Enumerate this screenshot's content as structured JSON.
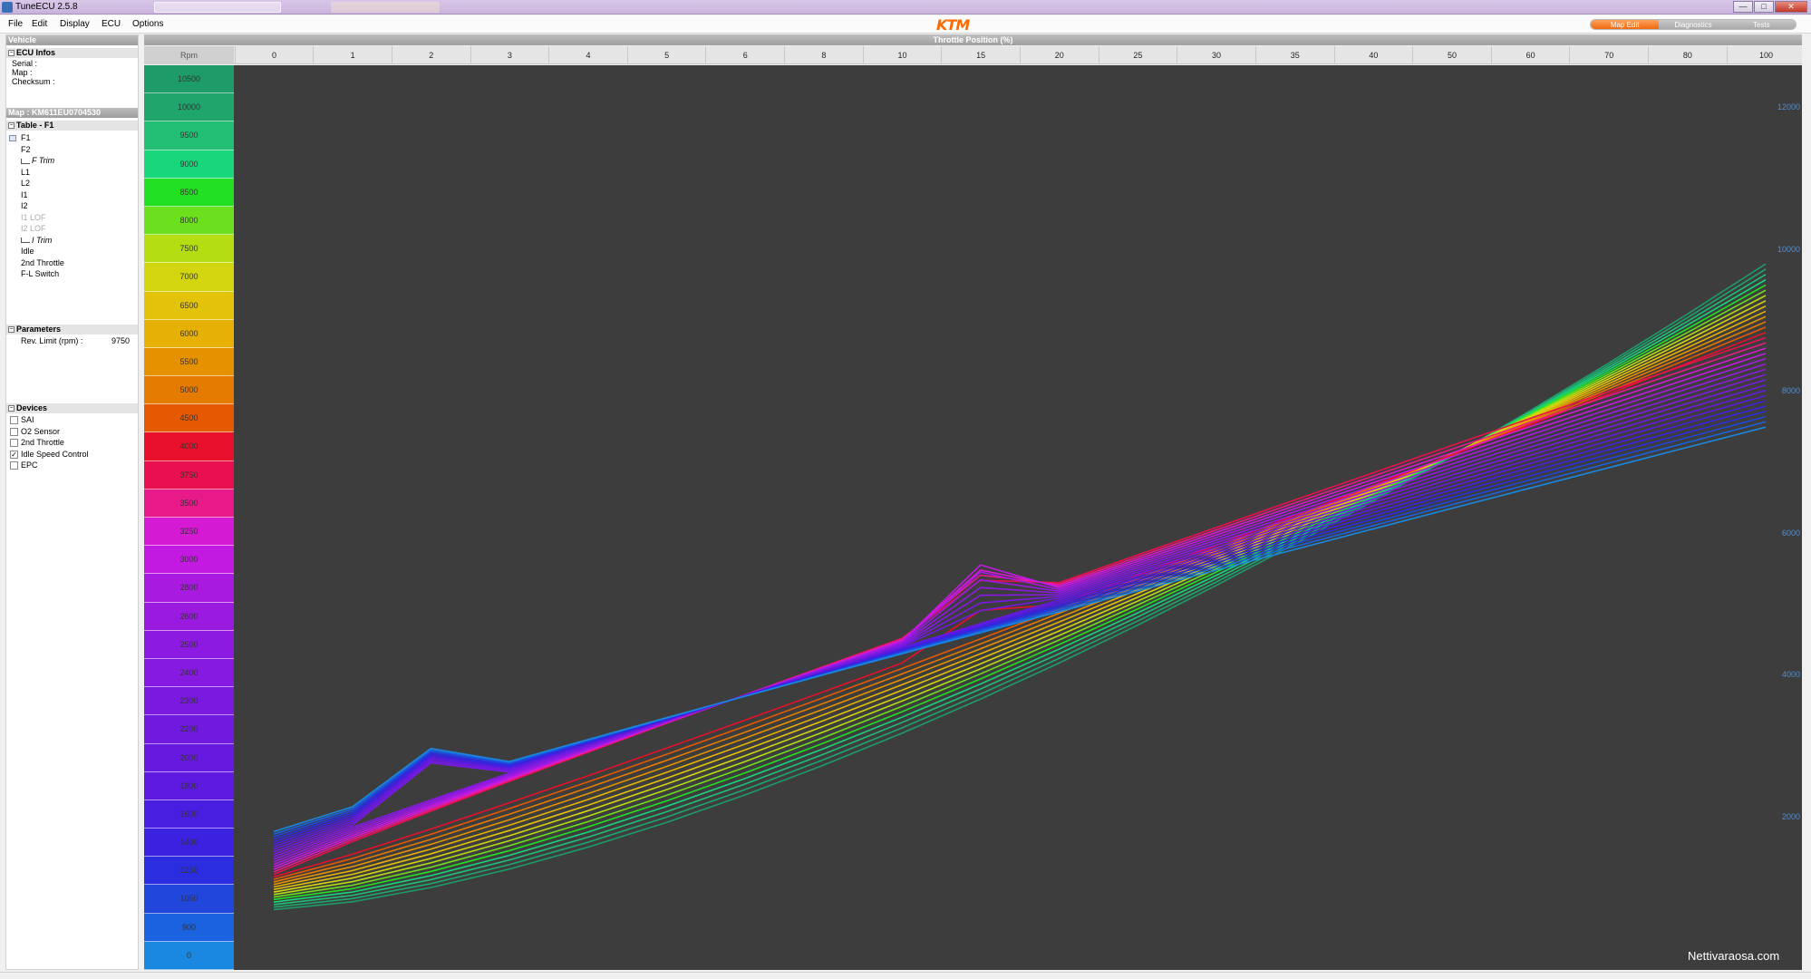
{
  "window": {
    "title": "TuneECU 2.5.8",
    "minimize": "—",
    "maximize": "□",
    "close": "✕"
  },
  "menu": [
    "File",
    "Edit",
    "Display",
    "ECU",
    "Options"
  ],
  "logo": "KTM",
  "mode_tabs": [
    {
      "label": "Map Edit",
      "active": true
    },
    {
      "label": "Diagnostics",
      "active": false
    },
    {
      "label": "Tests",
      "active": false
    }
  ],
  "left": {
    "vehicle_header": "Vehicle",
    "ecu_infos": {
      "label": "ECU Infos",
      "fields": [
        "Serial :",
        "Map :",
        "Checksum :"
      ]
    },
    "map_header": "Map : KM611EU0704530",
    "table": {
      "label": "Table - F1",
      "items": [
        {
          "label": "F1",
          "dim": false,
          "italic": false,
          "icon": "table-icon"
        },
        {
          "label": "F2",
          "dim": false,
          "italic": false
        },
        {
          "label": "F Trim",
          "dim": false,
          "italic": true,
          "icon": "trim-icon"
        },
        {
          "label": "L1",
          "dim": false,
          "italic": false
        },
        {
          "label": "L2",
          "dim": false,
          "italic": false
        },
        {
          "label": "I1",
          "dim": false,
          "italic": false
        },
        {
          "label": "I2",
          "dim": false,
          "italic": false
        },
        {
          "label": "I1 LOF",
          "dim": true,
          "italic": false
        },
        {
          "label": "I2 LOF",
          "dim": true,
          "italic": false
        },
        {
          "label": "I Trim",
          "dim": false,
          "italic": true,
          "icon": "trim-icon"
        },
        {
          "label": "Idle",
          "dim": false,
          "italic": false
        },
        {
          "label": "2nd Throttle",
          "dim": false,
          "italic": false
        },
        {
          "label": "F-L Switch",
          "dim": false,
          "italic": false
        }
      ]
    },
    "parameters": {
      "label": "Parameters",
      "rev_limit_label": "Rev. Limit (rpm) :",
      "rev_limit_value": "9750"
    },
    "devices": {
      "label": "Devices",
      "items": [
        {
          "label": "SAI",
          "checked": false
        },
        {
          "label": "O2 Sensor",
          "checked": false
        },
        {
          "label": "2nd Throttle",
          "checked": false
        },
        {
          "label": "Idle Speed Control",
          "checked": true
        },
        {
          "label": "EPC",
          "checked": false
        }
      ]
    }
  },
  "chart_data": {
    "type": "line",
    "title": "Throttle Position (%)",
    "row_header": "Rpm",
    "x": [
      "0",
      "1",
      "2",
      "3",
      "4",
      "5",
      "6",
      "8",
      "10",
      "15",
      "20",
      "25",
      "30",
      "35",
      "40",
      "50",
      "60",
      "70",
      "80",
      "100"
    ],
    "y_ticks": [
      2000,
      4000,
      6000,
      8000,
      10000,
      12000
    ],
    "ylim": [
      -150,
      12600
    ],
    "rpm_rows": [
      "10500",
      "10000",
      "9500",
      "9000",
      "8500",
      "8000",
      "7500",
      "7000",
      "6500",
      "6000",
      "5500",
      "5000",
      "4500",
      "4000",
      "3750",
      "3500",
      "3250",
      "3000",
      "2800",
      "2600",
      "2500",
      "2400",
      "2300",
      "2200",
      "2000",
      "1800",
      "1600",
      "1400",
      "1250",
      "1050",
      "900",
      "0"
    ],
    "row_colors": [
      "#1d9c68",
      "#1ea66d",
      "#20bf74",
      "#18d67a",
      "#22e022",
      "#6de01e",
      "#b4dd12",
      "#d3d60e",
      "#e3c20a",
      "#e6b004",
      "#e69200",
      "#e57b00",
      "#e55a00",
      "#e8102a",
      "#e8104e",
      "#e81a8a",
      "#d41ad2",
      "#c21ae0",
      "#a81ae0",
      "#9a1ae0",
      "#8d1ae0",
      "#861ae0",
      "#7a1ae0",
      "#701ae0",
      "#661ae0",
      "#5e1ae0",
      "#481ee0",
      "#3b22e0",
      "#2a2ee0",
      "#2046dc",
      "#1a62e0",
      "#1a88e0"
    ],
    "watermark": "Nettivaraosa.com"
  }
}
